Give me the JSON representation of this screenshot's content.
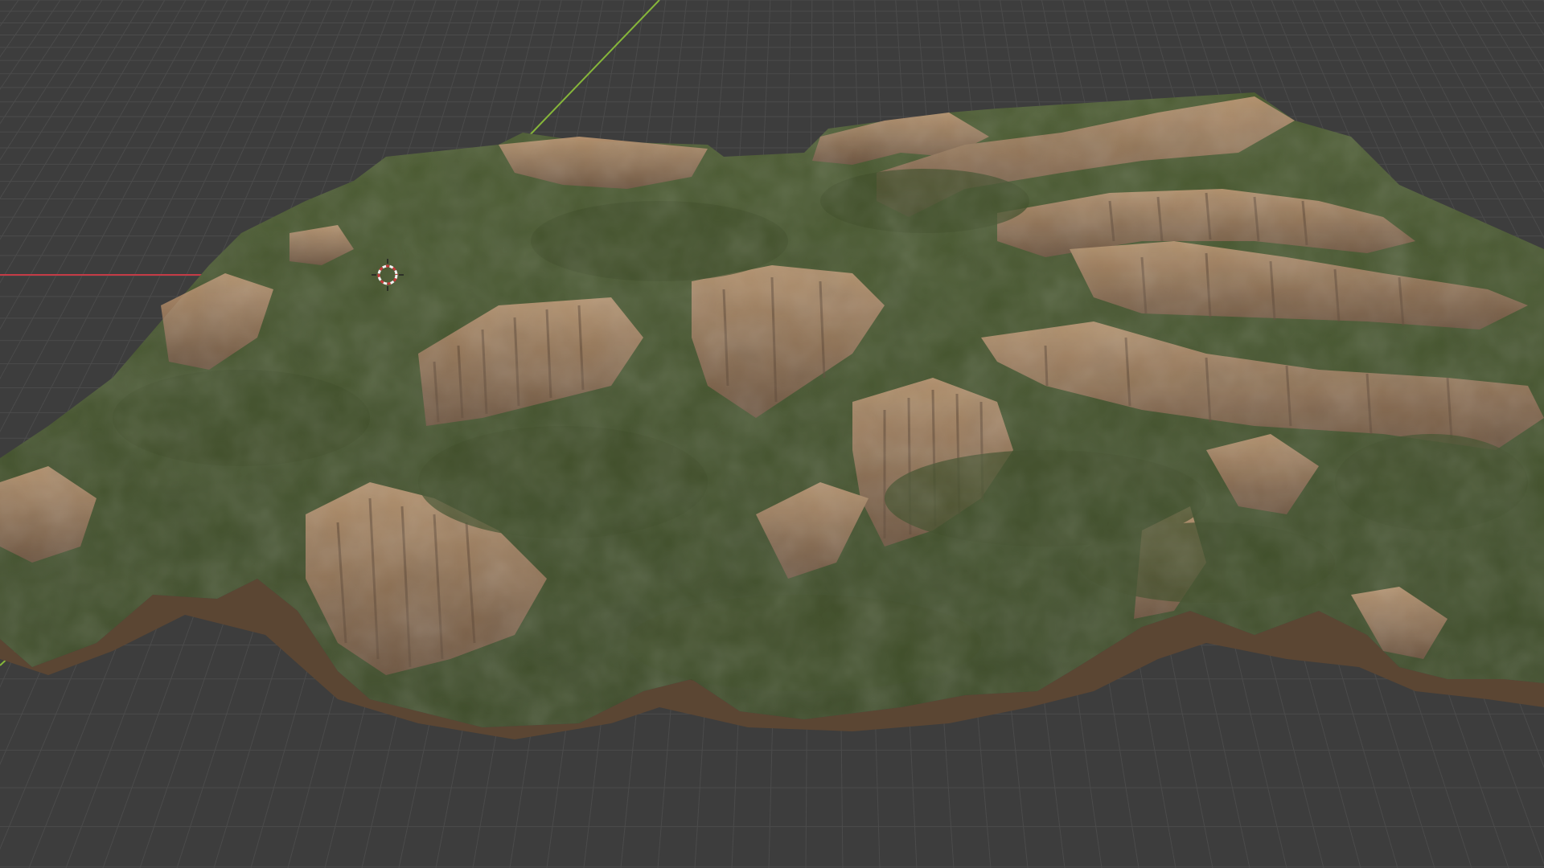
{
  "app": {
    "name": "3D viewport"
  },
  "viewport": {
    "background_color": "#3d3d3d",
    "grid_color": "#4b4b4b",
    "x_axis_color": "#c43b46",
    "y_axis_color": "#86b63a",
    "cursor_colors": [
      "#c53a3a",
      "#f2f2f2"
    ],
    "terrain_colors": {
      "grass": "#4b5a2f",
      "grass_dark": "#3a4727",
      "rock": "#a98563",
      "rock_dark": "#6f5540",
      "shadow": "#2d3521"
    }
  },
  "scene": {
    "objects": [
      {
        "name": "terrain",
        "kind": "mesh"
      },
      {
        "name": "3d-cursor",
        "kind": "cursor"
      }
    ]
  }
}
